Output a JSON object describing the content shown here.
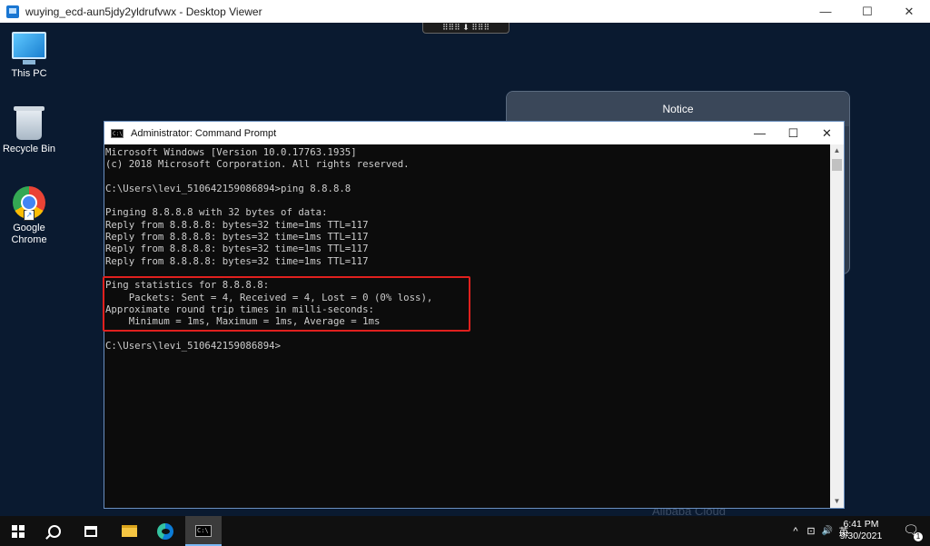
{
  "viewer": {
    "title": "wuying_ecd-aun5jdy2yldrufvwx - Desktop Viewer",
    "controls": {
      "minimize": "—",
      "maximize": "☐",
      "close": "✕"
    },
    "toolbar_handle": "⠿⠿⠿ ⬇ ⠿⠿⠿"
  },
  "desktop": {
    "icons": [
      {
        "label": "This PC",
        "icon": "computer-icon"
      },
      {
        "label": "Recycle Bin",
        "icon": "recycle-bin-icon"
      },
      {
        "label": "Google Chrome",
        "icon": "chrome-icon"
      }
    ],
    "notice": {
      "title": "Notice"
    },
    "watermark": "Alibaba Cloud"
  },
  "cmd": {
    "title": "Administrator: Command Prompt",
    "icon_text": "C:\\",
    "controls": {
      "minimize": "—",
      "maximize": "☐",
      "close": "✕"
    },
    "lines": [
      "Microsoft Windows [Version 10.0.17763.1935]",
      "(c) 2018 Microsoft Corporation. All rights reserved.",
      "",
      "C:\\Users\\levi_510642159086894>ping 8.8.8.8",
      "",
      "Pinging 8.8.8.8 with 32 bytes of data:",
      "Reply from 8.8.8.8: bytes=32 time=1ms TTL=117",
      "Reply from 8.8.8.8: bytes=32 time=1ms TTL=117",
      "Reply from 8.8.8.8: bytes=32 time=1ms TTL=117",
      "Reply from 8.8.8.8: bytes=32 time=1ms TTL=117",
      "",
      "Ping statistics for 8.8.8.8:",
      "    Packets: Sent = 4, Received = 4, Lost = 0 (0% loss),",
      "Approximate round trip times in milli-seconds:",
      "    Minimum = 1ms, Maximum = 1ms, Average = 1ms",
      "",
      "C:\\Users\\levi_510642159086894>"
    ],
    "scroll": {
      "up": "▲",
      "down": "▼"
    },
    "highlight_color": "#e0201e"
  },
  "taskbar": {
    "items": [
      {
        "icon": "windows-start-icon"
      },
      {
        "icon": "search-icon"
      },
      {
        "icon": "task-view-icon"
      },
      {
        "icon": "file-explorer-icon"
      },
      {
        "icon": "edge-icon"
      },
      {
        "icon": "command-prompt-icon",
        "active": true
      }
    ],
    "cmd_task_text": "C:\\",
    "tray": {
      "chevron": "^",
      "network": "⊡",
      "volume": "🔊",
      "ime": "英"
    },
    "clock": {
      "time": "6:41 PM",
      "date": "9/30/2021"
    },
    "notifications": {
      "glyph": "🗨",
      "count": "1"
    }
  }
}
